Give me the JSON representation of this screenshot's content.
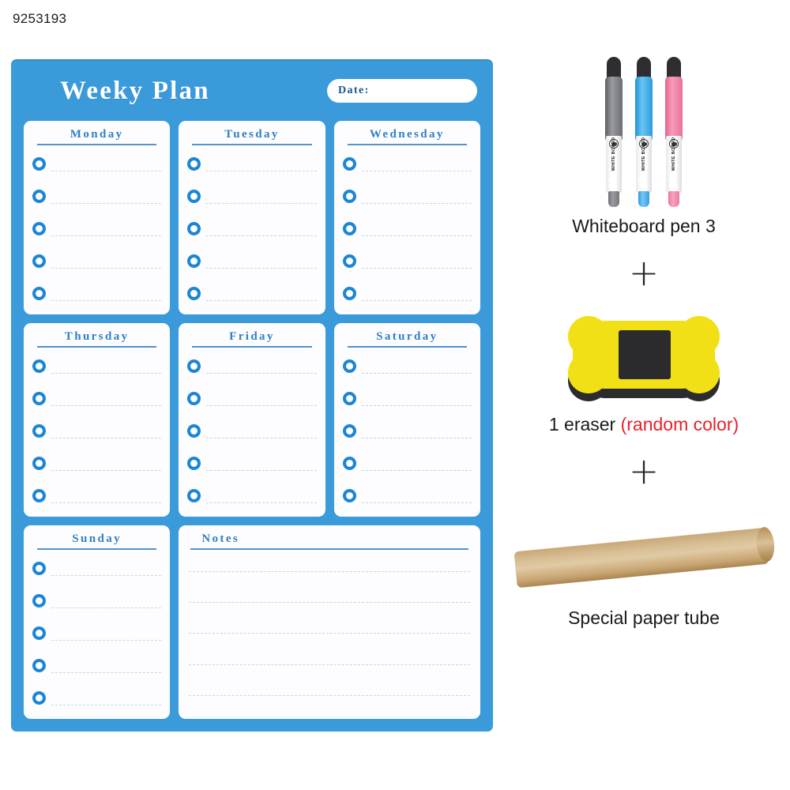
{
  "product_id": "9253193",
  "planner": {
    "title": "Weeky Plan",
    "date_label": "Date:",
    "accent_blue": "#3a9ada",
    "ring_blue": "#1c86d4",
    "heading_blue": "#2f7fc4",
    "rows_per_day": 5,
    "notes_lines": 5,
    "cells": [
      {
        "name": "monday",
        "title": "Monday",
        "type": "day"
      },
      {
        "name": "tuesday",
        "title": "Tuesday",
        "type": "day"
      },
      {
        "name": "wednesday",
        "title": "Wednesday",
        "type": "day"
      },
      {
        "name": "thursday",
        "title": "Thursday",
        "type": "day"
      },
      {
        "name": "friday",
        "title": "Friday",
        "type": "day"
      },
      {
        "name": "saturday",
        "title": "Saturday",
        "type": "day"
      },
      {
        "name": "sunday",
        "title": "Sunday",
        "type": "day"
      },
      {
        "name": "notes",
        "title": "Notes",
        "type": "notes"
      }
    ]
  },
  "accessories": {
    "pens": {
      "caption": "Whiteboard pen 3",
      "barrel_text": "WHITE BOARD",
      "items": [
        {
          "color_name": "gray",
          "color": "#7c7c82"
        },
        {
          "color_name": "blue",
          "color": "#3fa9e8"
        },
        {
          "color_name": "pink",
          "color": "#ef7d9e"
        }
      ]
    },
    "eraser": {
      "caption_main": "1 eraser ",
      "caption_note": "(random color)",
      "note_color": "#e8202a",
      "body_color": "#f2e016",
      "pad_color": "#2b2b2d"
    },
    "tube": {
      "caption": "Special paper tube",
      "color": "#d3b484"
    },
    "separator": "+"
  }
}
